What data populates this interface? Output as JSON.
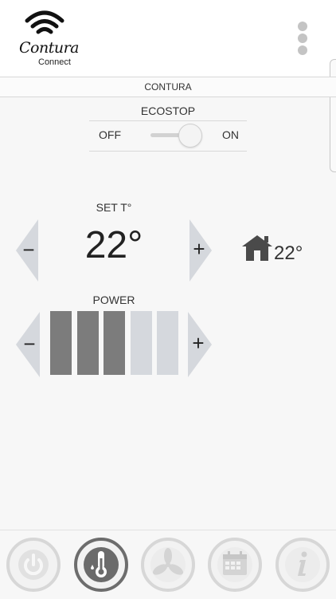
{
  "app": {
    "logo_text": "Contura",
    "logo_sub": "Connect"
  },
  "device": {
    "name": "CONTURA"
  },
  "ecostop": {
    "title": "ECOSTOP",
    "off_label": "OFF",
    "on_label": "ON",
    "state": "on"
  },
  "set_temp": {
    "label": "SET T°",
    "value": "22°",
    "decrease": "−",
    "increase": "+"
  },
  "room_temp": {
    "value": "22°",
    "icon": "house-icon"
  },
  "power": {
    "label": "POWER",
    "level": 3,
    "max": 5,
    "decrease": "−",
    "increase": "+"
  },
  "bottom_nav": {
    "items": [
      {
        "icon": "power-icon",
        "active": false
      },
      {
        "icon": "thermometer-icon",
        "active": true
      },
      {
        "icon": "fan-icon",
        "active": false
      },
      {
        "icon": "calendar-icon",
        "active": false
      },
      {
        "icon": "info-icon",
        "active": false
      }
    ]
  },
  "colors": {
    "bar_on": "#7c7c7c",
    "bar_off": "#d5d8dd",
    "arrow": "#d5d8dd",
    "nav_active_ring": "#6d6d6d",
    "nav_ring": "#d7d7d7"
  }
}
